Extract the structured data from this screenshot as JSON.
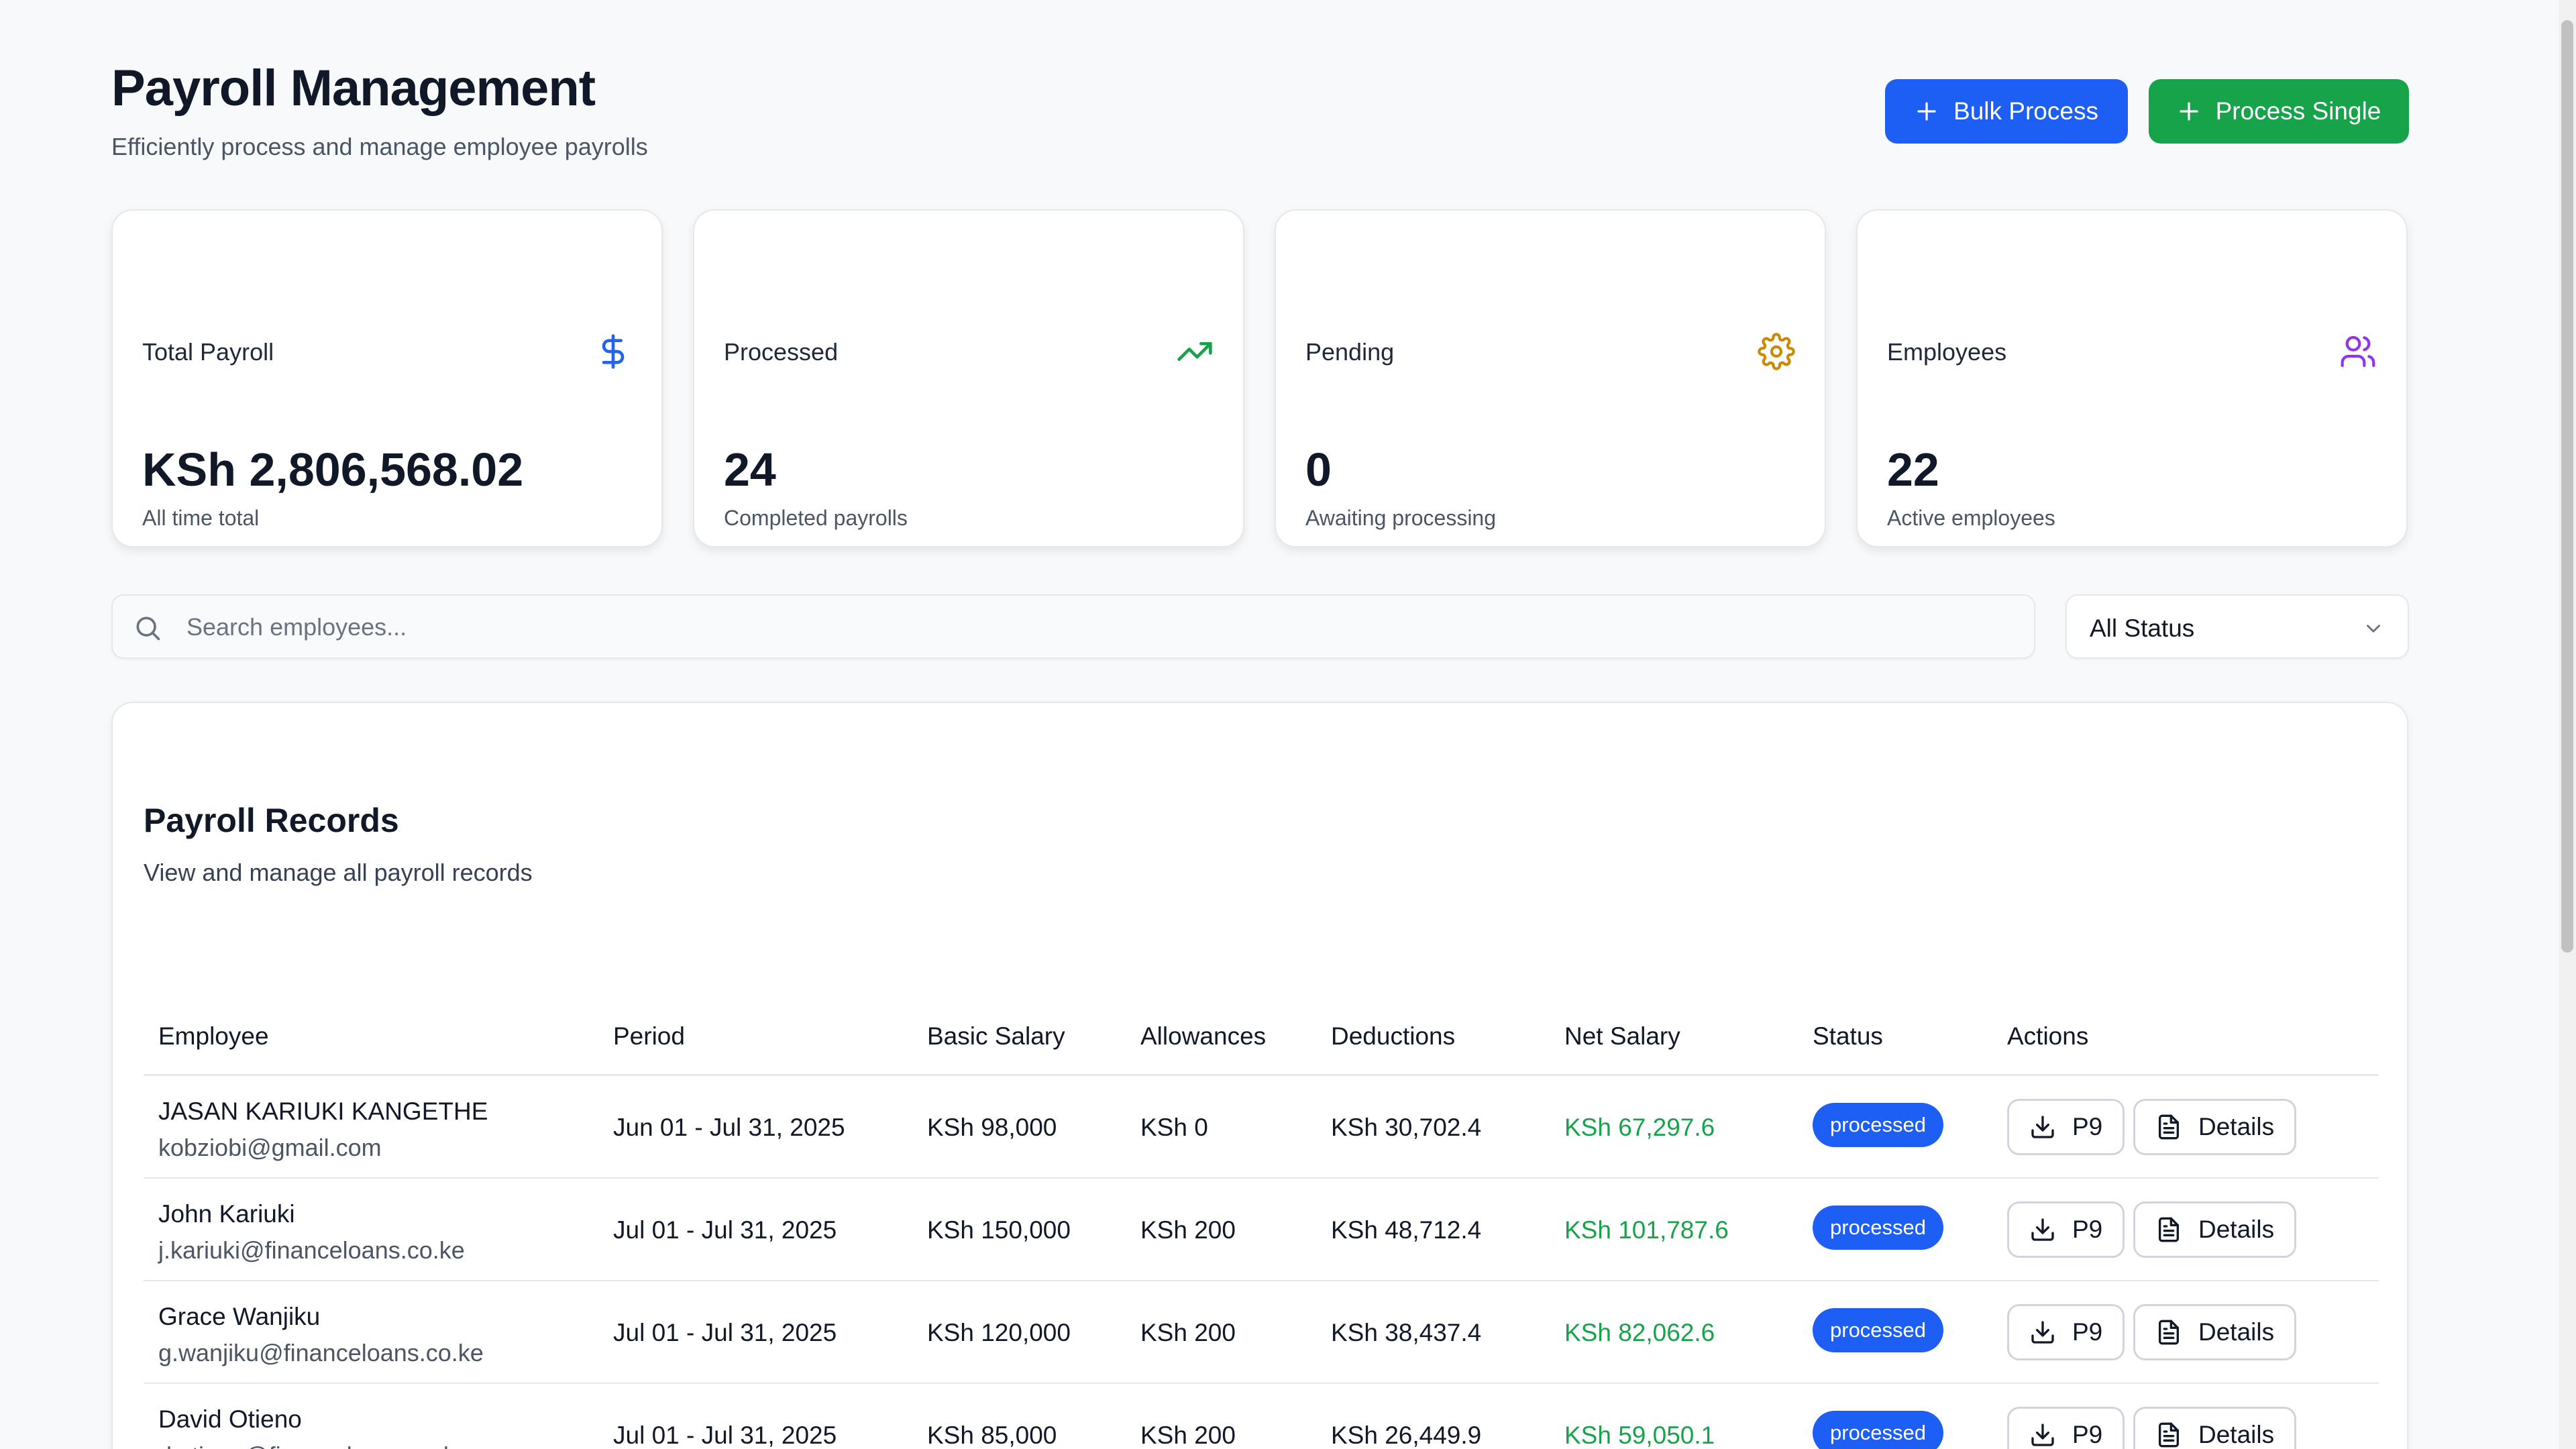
{
  "header": {
    "title": "Payroll Management",
    "subtitle": "Efficiently process and manage employee payrolls",
    "bulk_label": "Bulk Process",
    "single_label": "Process Single"
  },
  "stats": [
    {
      "label": "Total Payroll",
      "value": "KSh 2,806,568.02",
      "sub": "All time total",
      "icon": "dollar-icon",
      "color": "#2563eb"
    },
    {
      "label": "Processed",
      "value": "24",
      "sub": "Completed payrolls",
      "icon": "trending-up-icon",
      "color": "#16a34a"
    },
    {
      "label": "Pending",
      "value": "0",
      "sub": "Awaiting processing",
      "icon": "gear-icon",
      "color": "#ca8a04"
    },
    {
      "label": "Employees",
      "value": "22",
      "sub": "Active employees",
      "icon": "users-icon",
      "color": "#9333ea"
    }
  ],
  "search": {
    "placeholder": "Search employees...",
    "value": ""
  },
  "status_filter": {
    "selected": "All Status"
  },
  "records": {
    "title": "Payroll Records",
    "subtitle": "View and manage all payroll records",
    "columns": [
      "Employee",
      "Period",
      "Basic Salary",
      "Allowances",
      "Deductions",
      "Net Salary",
      "Status",
      "Actions"
    ],
    "rows": [
      {
        "name": "JASAN KARIUKI KANGETHE",
        "email": "kobziobi@gmail.com",
        "period": "Jun 01 - Jul 31, 2025",
        "basic": "KSh 98,000",
        "allowances": "KSh 0",
        "deductions": "KSh 30,702.4",
        "net": "KSh 67,297.6",
        "status": "processed"
      },
      {
        "name": "John Kariuki",
        "email": "j.kariuki@financeloans.co.ke",
        "period": "Jul 01 - Jul 31, 2025",
        "basic": "KSh 150,000",
        "allowances": "KSh 200",
        "deductions": "KSh 48,712.4",
        "net": "KSh 101,787.6",
        "status": "processed"
      },
      {
        "name": "Grace Wanjiku",
        "email": "g.wanjiku@financeloans.co.ke",
        "period": "Jul 01 - Jul 31, 2025",
        "basic": "KSh 120,000",
        "allowances": "KSh 200",
        "deductions": "KSh 38,437.4",
        "net": "KSh 82,062.6",
        "status": "processed"
      },
      {
        "name": "David Otieno",
        "email": "d.otieno@financeloans.co.ke",
        "period": "Jul 01 - Jul 31, 2025",
        "basic": "KSh 85,000",
        "allowances": "KSh 200",
        "deductions": "KSh 26,449.9",
        "net": "KSh 59,050.1",
        "status": "processed"
      }
    ],
    "actions": {
      "p9_label": "P9",
      "details_label": "Details"
    }
  },
  "colors": {
    "primary": "#1d5ef5",
    "success": "#16a34a",
    "net_salary": "#16a34a"
  }
}
